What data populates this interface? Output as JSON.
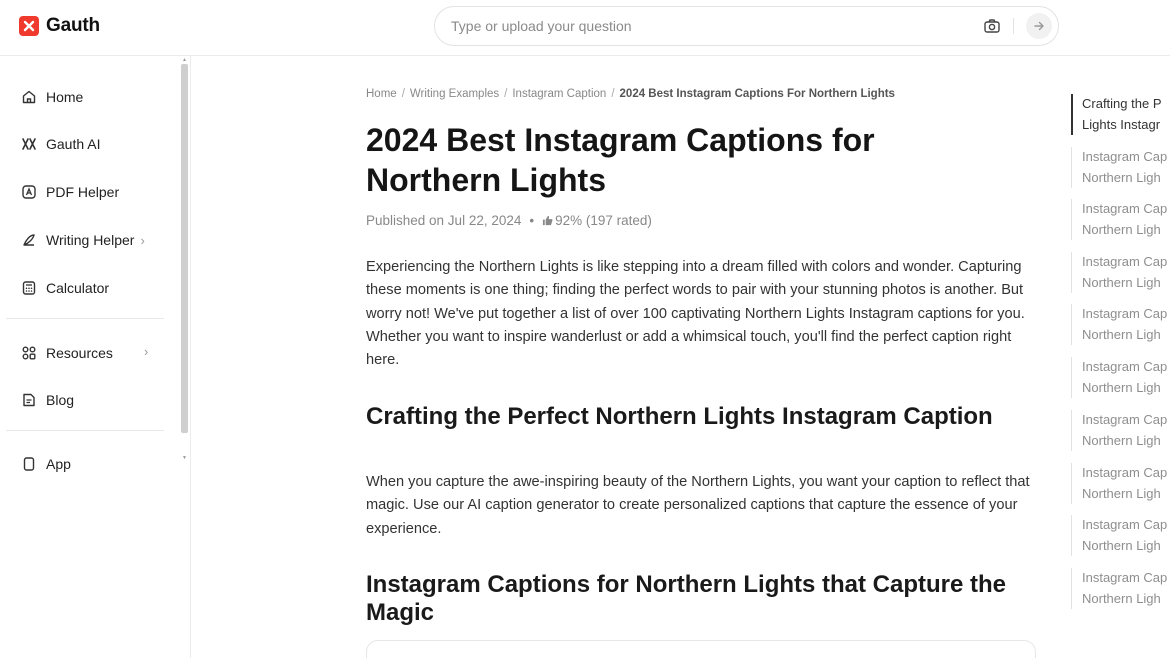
{
  "header": {
    "logo_text": "Gauth",
    "search_placeholder": "Type or upload your question"
  },
  "sidebar": {
    "items": [
      {
        "label": "Home",
        "icon": "home-icon"
      },
      {
        "label": "Gauth AI",
        "icon": "gauth-ai-icon"
      },
      {
        "label": "PDF Helper",
        "icon": "pdf-icon"
      },
      {
        "label": "Writing Helper",
        "icon": "pen-icon",
        "chevron": "›"
      },
      {
        "label": "Calculator",
        "icon": "calculator-icon"
      },
      {
        "label": "Resources",
        "icon": "grid-icon",
        "chevron": "›"
      },
      {
        "label": "Blog",
        "icon": "blog-icon"
      },
      {
        "label": "App",
        "icon": "phone-icon"
      }
    ]
  },
  "breadcrumb": {
    "items": [
      "Home",
      "Writing Examples",
      "Instagram Caption"
    ],
    "current": "2024 Best Instagram Captions For Northern Lights",
    "separator": "/"
  },
  "article": {
    "title": "2024 Best Instagram Captions for Northern Lights",
    "published": "Published on Jul 22, 2024",
    "dot": "•",
    "rating": "92% (197 rated)",
    "intro": "Experiencing the Northern Lights is like stepping into a dream filled with colors and wonder. Capturing these moments is one thing; finding the perfect words to pair with your stunning photos is another. But worry not! We've put together a list of over 100 captivating Northern Lights Instagram captions for you. Whether you want to inspire wanderlust or add a whimsical touch, you'll find the perfect caption right here.",
    "section1_title": "Crafting the Perfect Northern Lights Instagram Caption",
    "section1_text": "When you capture the awe-inspiring beauty of the Northern Lights, you want your caption to reflect that magic. Use our AI caption generator to create personalized captions that capture the essence of your experience.",
    "section2_title": "Instagram Captions for Northern Lights that Capture the Magic"
  },
  "toc": {
    "items": [
      {
        "line1": "Crafting the P",
        "line2": "Lights Instagr",
        "active": true
      },
      {
        "line1": "Instagram Cap",
        "line2": "Northern Ligh"
      },
      {
        "line1": "Instagram Cap",
        "line2": "Northern Ligh"
      },
      {
        "line1": "Instagram Cap",
        "line2": "Northern Ligh"
      },
      {
        "line1": "Instagram Cap",
        "line2": "Northern Ligh"
      },
      {
        "line1": "Instagram Cap",
        "line2": "Northern Ligh"
      },
      {
        "line1": "Instagram Cap",
        "line2": "Northern Ligh"
      },
      {
        "line1": "Instagram Cap",
        "line2": "Northern Ligh"
      },
      {
        "line1": "Instagram Cap",
        "line2": "Northern Ligh"
      },
      {
        "line1": "Instagram Cap",
        "line2": "Northern Ligh"
      }
    ]
  },
  "colors": {
    "brand": "#f03a2e",
    "text": "#333333",
    "muted": "#888888"
  }
}
